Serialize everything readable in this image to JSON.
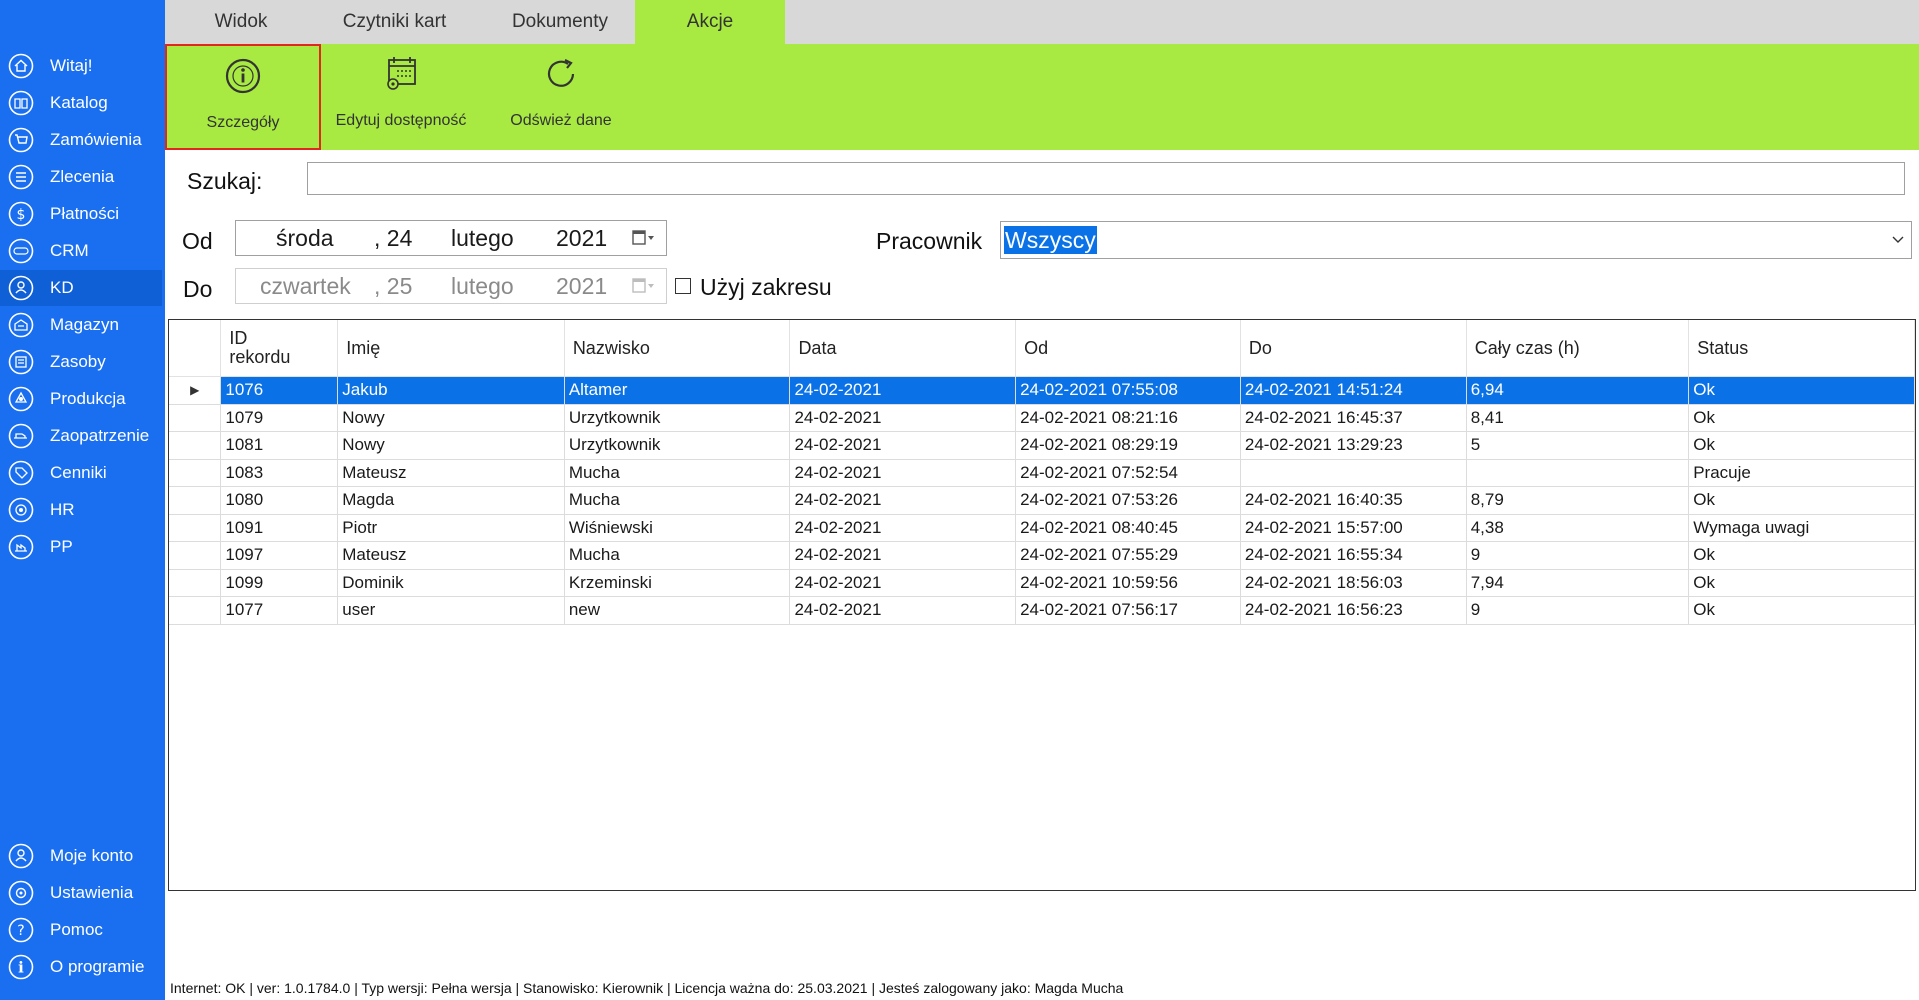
{
  "sidebar": {
    "items": [
      {
        "label": "Witaj!",
        "icon": "home-icon",
        "active": false
      },
      {
        "label": "Katalog",
        "icon": "book-icon",
        "active": false
      },
      {
        "label": "Zamówienia",
        "icon": "cart-icon",
        "active": false
      },
      {
        "label": "Zlecenia",
        "icon": "list-icon",
        "active": false
      },
      {
        "label": "Płatności",
        "icon": "dollar-icon",
        "active": false
      },
      {
        "label": "CRM",
        "icon": "crm-icon",
        "active": false
      },
      {
        "label": "KD",
        "icon": "user-icon",
        "active": true
      },
      {
        "label": "Magazyn",
        "icon": "warehouse-icon",
        "active": false
      },
      {
        "label": "Zasoby",
        "icon": "resources-icon",
        "active": false
      },
      {
        "label": "Produkcja",
        "icon": "production-icon",
        "active": false
      },
      {
        "label": "Zaopatrzenie",
        "icon": "supply-icon",
        "active": false
      },
      {
        "label": "Cenniki",
        "icon": "tag-icon",
        "active": false
      },
      {
        "label": "HR",
        "icon": "hr-icon",
        "active": false
      },
      {
        "label": "PP",
        "icon": "pp-icon",
        "active": false
      }
    ],
    "bottom_items": [
      {
        "label": "Moje konto",
        "icon": "account-icon"
      },
      {
        "label": "Ustawienia",
        "icon": "gear-icon"
      },
      {
        "label": "Pomoc",
        "icon": "help-icon"
      },
      {
        "label": "O programie",
        "icon": "info-icon"
      }
    ]
  },
  "tabs": [
    {
      "label": "Widok",
      "active": false
    },
    {
      "label": "Czytniki kart",
      "active": false
    },
    {
      "label": "Dokumenty",
      "active": false
    },
    {
      "label": "Akcje",
      "active": true
    }
  ],
  "ribbon": {
    "buttons": [
      {
        "label": "Szczegóły",
        "icon": "info-circle-icon",
        "selected": true
      },
      {
        "label": "Edytuj dostępność",
        "icon": "calendar-gear-icon",
        "selected": false
      },
      {
        "label": "Odśwież dane",
        "icon": "refresh-icon",
        "selected": false
      }
    ]
  },
  "filters": {
    "search_label": "Szukaj:",
    "search_value": "",
    "from_label": "Od",
    "from_date": {
      "weekday": "środa",
      "day": ", 24",
      "month": "lutego",
      "year": "2021"
    },
    "to_label": "Do",
    "to_date": {
      "weekday": "czwartek",
      "day": ", 25",
      "month": "lutego",
      "year": "2021"
    },
    "use_range_label": "Użyj zakresu",
    "use_range_checked": false,
    "worker_label": "Pracownik",
    "worker_value": "Wszyscy"
  },
  "grid": {
    "columns": [
      "ID rekordu",
      "Imię",
      "Nazwisko",
      "Data",
      "Od",
      "Do",
      "Cały czas (h)",
      "Status"
    ],
    "selected_index": 0,
    "rows": [
      [
        "1076",
        "Jakub",
        "Altamer",
        "24-02-2021",
        "24-02-2021 07:55:08",
        "24-02-2021 14:51:24",
        "6,94",
        "Ok"
      ],
      [
        "1079",
        "Nowy",
        "Urzytkownik",
        "24-02-2021",
        "24-02-2021 08:21:16",
        "24-02-2021 16:45:37",
        "8,41",
        "Ok"
      ],
      [
        "1081",
        "Nowy",
        "Urzytkownik",
        "24-02-2021",
        "24-02-2021 08:29:19",
        "24-02-2021 13:29:23",
        "5",
        "Ok"
      ],
      [
        "1083",
        "Mateusz",
        "Mucha",
        "24-02-2021",
        "24-02-2021 07:52:54",
        "",
        "",
        "Pracuje"
      ],
      [
        "1080",
        "Magda",
        "Mucha",
        "24-02-2021",
        "24-02-2021 07:53:26",
        "24-02-2021 16:40:35",
        "8,79",
        "Ok"
      ],
      [
        "1091",
        "Piotr",
        "Wiśniewski",
        "24-02-2021",
        "24-02-2021 08:40:45",
        "24-02-2021 15:57:00",
        "4,38",
        "Wymaga uwagi"
      ],
      [
        "1097",
        "Mateusz",
        "Mucha",
        "24-02-2021",
        "24-02-2021 07:55:29",
        "24-02-2021 16:55:34",
        "9",
        "Ok"
      ],
      [
        "1099",
        "Dominik",
        "Krzeminski",
        "24-02-2021",
        "24-02-2021 10:59:56",
        "24-02-2021 18:56:03",
        "7,94",
        "Ok"
      ],
      [
        "1077",
        "user",
        "new",
        "24-02-2021",
        "24-02-2021 07:56:17",
        "24-02-2021 16:56:23",
        "9",
        "Ok"
      ]
    ]
  },
  "statusbar": {
    "text": "Internet: OK  |   ver: 1.0.1784.0   |   Typ wersji: Pełna wersja   |   Stanowisko: Kierownik   |   Licencja ważna do: 25.03.2021  |   Jesteś zalogowany jako: Magda Mucha"
  },
  "colors": {
    "sidebar": "#1a6ff0",
    "ribbon": "#a8ea42",
    "selection": "#0a72e6",
    "highlight_border": "#e0281e"
  }
}
